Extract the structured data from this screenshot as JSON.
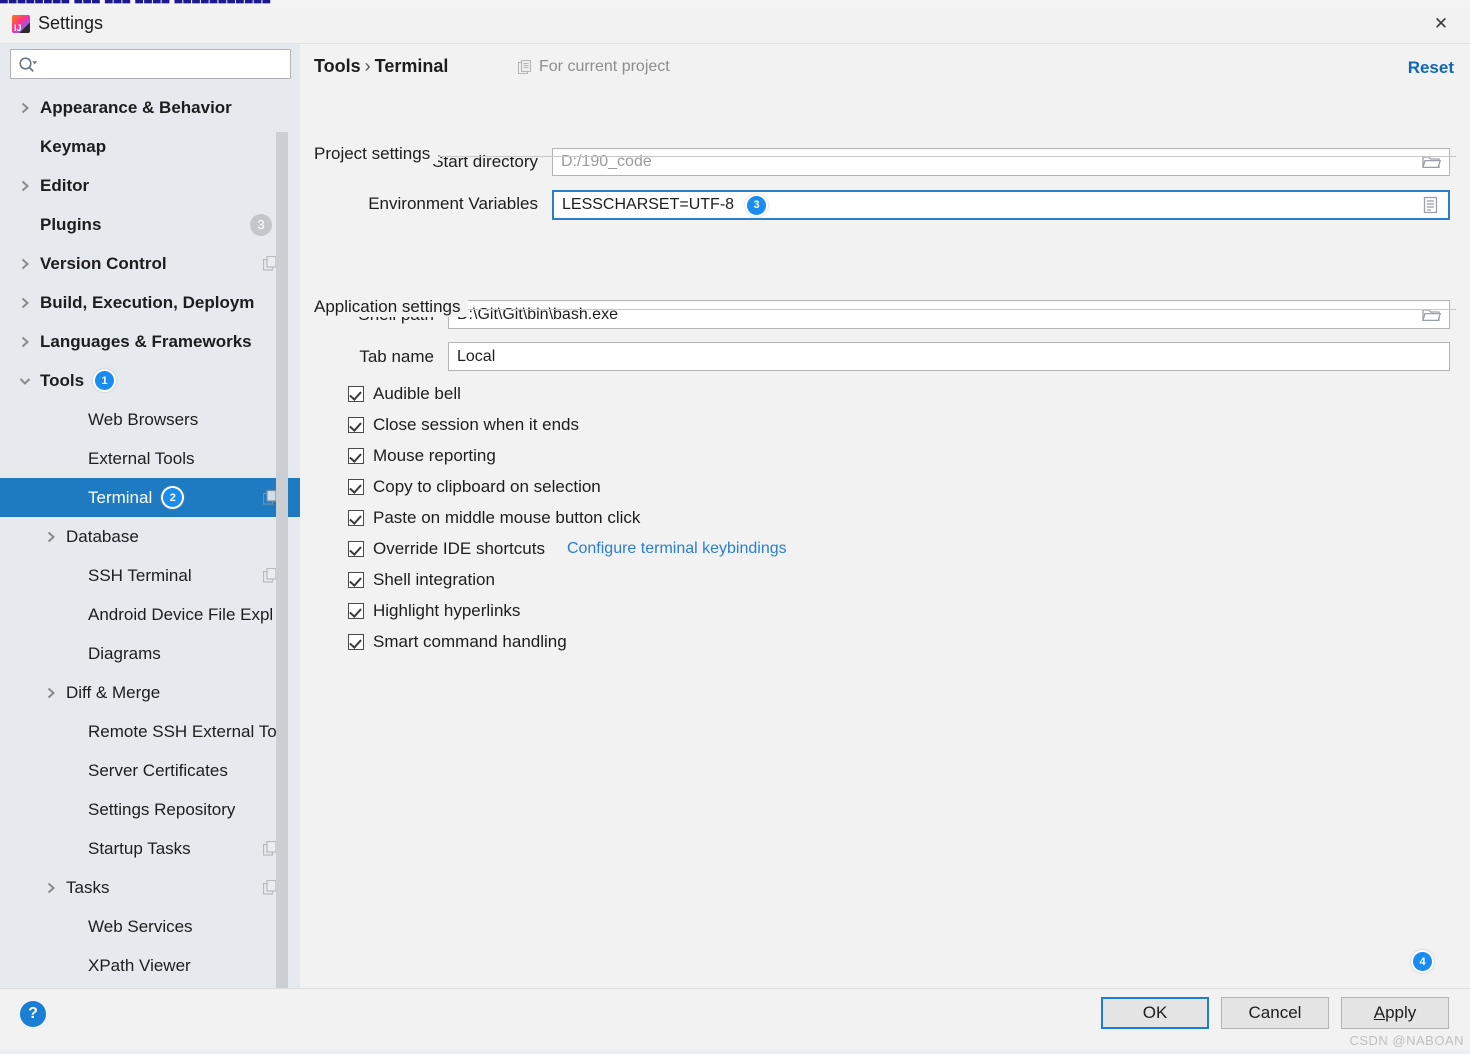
{
  "window": {
    "title": "Settings",
    "app_icon": "intellij-idea-icon",
    "close_icon": "close-icon",
    "top_artifact_text": "████████  ███  ███ ████  ███████████"
  },
  "sidebar": {
    "search": {
      "value": "",
      "placeholder": "",
      "icon": "search-icon"
    },
    "items": [
      {
        "label": "Appearance & Behavior",
        "level": "top",
        "arrow": "right",
        "badge": null,
        "count": null,
        "copy": false,
        "selected": false
      },
      {
        "label": "Keymap",
        "level": "top",
        "arrow": "none",
        "badge": null,
        "count": null,
        "copy": false,
        "selected": false
      },
      {
        "label": "Editor",
        "level": "top",
        "arrow": "right",
        "badge": null,
        "count": null,
        "copy": false,
        "selected": false
      },
      {
        "label": "Plugins",
        "level": "top",
        "arrow": "none",
        "badge": null,
        "count": "3",
        "copy": false,
        "selected": false
      },
      {
        "label": "Version Control",
        "level": "top",
        "arrow": "right",
        "badge": null,
        "count": null,
        "copy": true,
        "selected": false
      },
      {
        "label": "Build, Execution, Deploym",
        "level": "top",
        "arrow": "right",
        "badge": null,
        "count": null,
        "copy": false,
        "selected": false
      },
      {
        "label": "Languages & Frameworks",
        "level": "top",
        "arrow": "right",
        "badge": null,
        "count": null,
        "copy": false,
        "selected": false
      },
      {
        "label": "Tools",
        "level": "top",
        "arrow": "down",
        "badge": "1",
        "count": null,
        "copy": false,
        "selected": false
      },
      {
        "label": "Web Browsers",
        "level": "child",
        "arrow": "none",
        "badge": null,
        "count": null,
        "copy": false,
        "selected": false
      },
      {
        "label": "External Tools",
        "level": "child",
        "arrow": "none",
        "badge": null,
        "count": null,
        "copy": false,
        "selected": false
      },
      {
        "label": "Terminal",
        "level": "child",
        "arrow": "none",
        "badge": "2",
        "count": null,
        "copy": true,
        "selected": true
      },
      {
        "label": "Database",
        "level": "child",
        "arrow": "right",
        "badge": null,
        "count": null,
        "copy": false,
        "selected": false
      },
      {
        "label": "SSH Terminal",
        "level": "child",
        "arrow": "none",
        "badge": null,
        "count": null,
        "copy": true,
        "selected": false
      },
      {
        "label": "Android Device File Expl",
        "level": "child",
        "arrow": "none",
        "badge": null,
        "count": null,
        "copy": false,
        "selected": false
      },
      {
        "label": "Diagrams",
        "level": "child",
        "arrow": "none",
        "badge": null,
        "count": null,
        "copy": false,
        "selected": false
      },
      {
        "label": "Diff & Merge",
        "level": "child",
        "arrow": "right",
        "badge": null,
        "count": null,
        "copy": false,
        "selected": false
      },
      {
        "label": "Remote SSH External Too",
        "level": "child",
        "arrow": "none",
        "badge": null,
        "count": null,
        "copy": false,
        "selected": false
      },
      {
        "label": "Server Certificates",
        "level": "child",
        "arrow": "none",
        "badge": null,
        "count": null,
        "copy": false,
        "selected": false
      },
      {
        "label": "Settings Repository",
        "level": "child",
        "arrow": "none",
        "badge": null,
        "count": null,
        "copy": false,
        "selected": false
      },
      {
        "label": "Startup Tasks",
        "level": "child",
        "arrow": "none",
        "badge": null,
        "count": null,
        "copy": true,
        "selected": false
      },
      {
        "label": "Tasks",
        "level": "child",
        "arrow": "right",
        "badge": null,
        "count": null,
        "copy": true,
        "selected": false
      },
      {
        "label": "Web Services",
        "level": "child",
        "arrow": "none",
        "badge": null,
        "count": null,
        "copy": false,
        "selected": false
      },
      {
        "label": "XPath Viewer",
        "level": "child",
        "arrow": "none",
        "badge": null,
        "count": null,
        "copy": false,
        "selected": false
      }
    ]
  },
  "main": {
    "breadcrumb": {
      "root": "Tools",
      "separator": "›",
      "leaf": "Terminal"
    },
    "scope_note": {
      "label": "For current project",
      "icon": "copy-document-icon"
    },
    "reset_label": "Reset",
    "project_settings": {
      "section_title": "Project settings",
      "start_directory": {
        "label": "Start directory",
        "value": "D:/190_code",
        "is_placeholder": true,
        "browse_icon": "folder-icon"
      },
      "environment_variables": {
        "label": "Environment Variables",
        "value": "LESSCHARSET=UTF-8",
        "badge": "3",
        "browse_icon": "list-document-icon",
        "focused": true
      }
    },
    "application_settings": {
      "section_title": "Application settings",
      "shell_path": {
        "label": "Shell path",
        "value": "D:\\Git\\Git\\bin\\bash.exe",
        "browse_icon": "folder-icon"
      },
      "tab_name": {
        "label": "Tab name",
        "value": "Local"
      },
      "checkboxes": [
        {
          "label": "Audible bell",
          "checked": true,
          "link": null
        },
        {
          "label": "Close session when it ends",
          "checked": true,
          "link": null
        },
        {
          "label": "Mouse reporting",
          "checked": true,
          "link": null
        },
        {
          "label": "Copy to clipboard on selection",
          "checked": true,
          "link": null
        },
        {
          "label": "Paste on middle mouse button click",
          "checked": true,
          "link": null
        },
        {
          "label": "Override IDE shortcuts",
          "checked": true,
          "link": "Configure terminal keybindings"
        },
        {
          "label": "Shell integration",
          "checked": true,
          "link": null
        },
        {
          "label": "Highlight hyperlinks",
          "checked": true,
          "link": null
        },
        {
          "label": "Smart command handling",
          "checked": true,
          "link": null
        }
      ]
    },
    "badge_4": "4"
  },
  "footer": {
    "help_label": "?",
    "ok_label": "OK",
    "cancel_label": "Cancel",
    "apply_mnemonic": "A",
    "apply_rest": "pply",
    "watermark": "CSDN @NABOAN"
  },
  "colors": {
    "accent_blue": "#1f7bc1",
    "badge_blue": "#1a8cf0",
    "link_blue": "#2a7fcc",
    "reset_blue": "#1266b3",
    "sidebar_bg": "#e6eaee",
    "panel_bg": "#f2f2f2"
  }
}
